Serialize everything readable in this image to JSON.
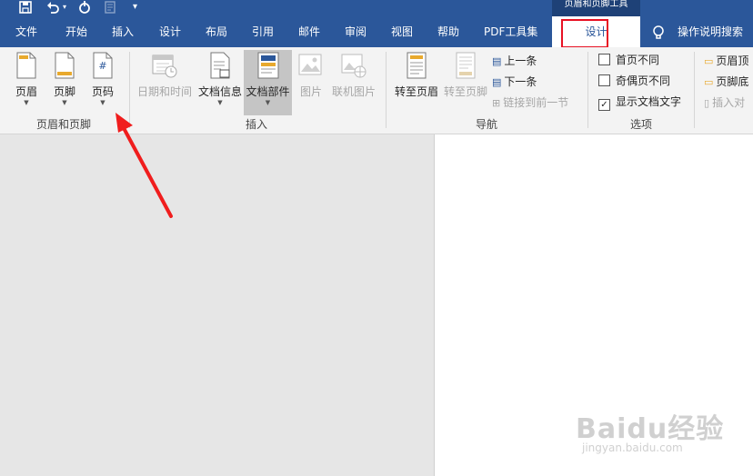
{
  "titlebar": {
    "context_tab_title": "页眉和页脚工具",
    "icons": [
      "save-icon",
      "undo-icon",
      "undo-dropdown-icon",
      "redo-icon",
      "touch-mode-icon",
      "customize-qat-icon"
    ]
  },
  "menu": {
    "tabs": [
      {
        "label": "文件"
      },
      {
        "label": "开始"
      },
      {
        "label": "插入"
      },
      {
        "label": "设计"
      },
      {
        "label": "布局"
      },
      {
        "label": "引用"
      },
      {
        "label": "邮件"
      },
      {
        "label": "审阅"
      },
      {
        "label": "视图"
      },
      {
        "label": "帮助"
      },
      {
        "label": "PDF工具集"
      },
      {
        "label": "设计",
        "active": true
      }
    ],
    "tell_me": "操作说明搜索"
  },
  "ribbon": {
    "header_footer": {
      "label": "页眉和页脚",
      "buttons": [
        {
          "label": "页眉"
        },
        {
          "label": "页脚"
        },
        {
          "label": "页码"
        }
      ]
    },
    "insert": {
      "label": "插入",
      "buttons": [
        {
          "label": "日期和时间",
          "enabled": false
        },
        {
          "label": "文档信息",
          "enabled": true
        },
        {
          "label": "文档部件",
          "enabled": true,
          "highlighted": true
        },
        {
          "label": "图片",
          "enabled": false
        },
        {
          "label": "联机图片",
          "enabled": false
        }
      ]
    },
    "navigation": {
      "label": "导航",
      "buttons": [
        {
          "label": "转至页眉",
          "enabled": true
        },
        {
          "label": "转至页脚",
          "enabled": false
        },
        {
          "label": "上一条",
          "enabled": true
        },
        {
          "label": "下一条",
          "enabled": true
        },
        {
          "label": "链接到前一节",
          "enabled": false
        }
      ]
    },
    "options": {
      "label": "选项",
      "checkboxes": [
        {
          "label": "首页不同",
          "checked": false
        },
        {
          "label": "奇偶页不同",
          "checked": false
        },
        {
          "label": "显示文档文字",
          "checked": true
        }
      ]
    },
    "position": {
      "buttons": [
        {
          "label": "页眉顶"
        },
        {
          "label": "页脚底"
        },
        {
          "label": "插入对",
          "enabled": false
        }
      ]
    }
  },
  "colors": {
    "accent": "#2b579a",
    "highlight_box": "#e81123",
    "arrow": "#f01d1d"
  },
  "watermark": {
    "brand": "Baidu经验",
    "url": "jingyan.baidu.com"
  }
}
